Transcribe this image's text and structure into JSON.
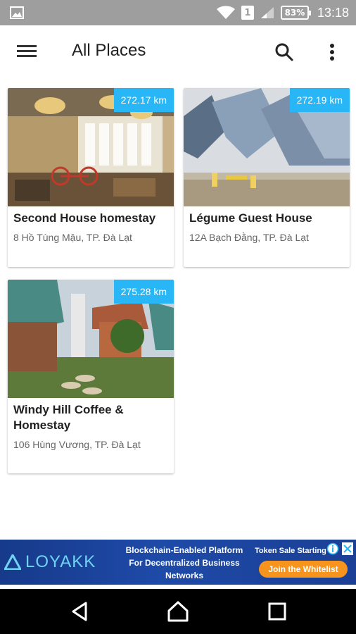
{
  "status_bar": {
    "time": "13:18",
    "battery": "83%",
    "sim": "1"
  },
  "app_bar": {
    "title": "All Places"
  },
  "places": [
    {
      "name": "Second House homestay",
      "address": "8 Hồ Tùng Mậu, TP. Đà Lạt",
      "distance": "272.17 km"
    },
    {
      "name": "Légume Guest House",
      "address": "12A Bạch Đằng,  TP. Đà Lạt",
      "distance": "272.19 km"
    },
    {
      "name": "Windy Hill Coffee & Homestay",
      "address": "106 Hùng Vương, TP. Đà Lạt",
      "distance": "275.28 km"
    }
  ],
  "ad": {
    "brand": "LOYAKK",
    "headline": "Blockchain-Enabled Platform For Decentralized Business Networks",
    "sale_text": "Token Sale Starting",
    "cta": "Join the Whitelist"
  },
  "colors": {
    "status_bar": "#9e9e9e",
    "badge": "#29b6f6",
    "ad_bg": "#1e4aa8",
    "ad_cta": "#f7941d"
  }
}
